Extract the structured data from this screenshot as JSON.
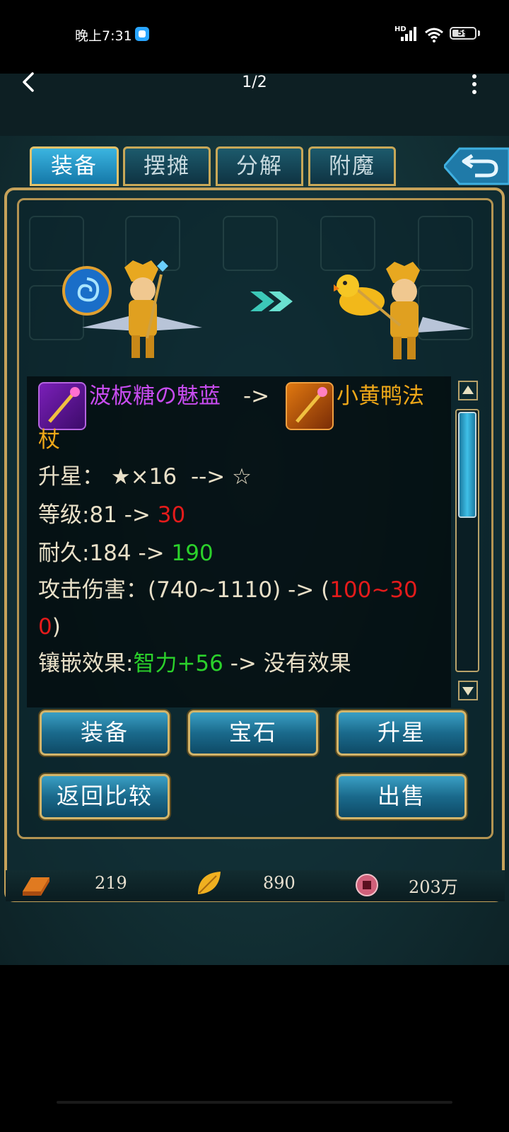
{
  "status_bar": {
    "time": "晚上7:31",
    "network": "HD",
    "battery": "59",
    "battery_level": 0.59
  },
  "viewer": {
    "page_indicator": "1/2"
  },
  "tabs": [
    {
      "label": "装备",
      "active": true
    },
    {
      "label": "摆摊",
      "active": false
    },
    {
      "label": "分解",
      "active": false
    },
    {
      "label": "附魔",
      "active": false
    }
  ],
  "compare": {
    "old_item_name": "波板糖の魅蓝",
    "arrow": "->",
    "new_item_name_part1": "小黄鸭法",
    "new_item_name_part2": "杖",
    "star_label": "升星：",
    "star_old": "★×16",
    "star_arrow": "-->",
    "star_new": "☆",
    "level_label": "等级:81 ->",
    "level_new": "30",
    "durability_label": "耐久:184 ->",
    "durability_new": "190",
    "attack_label": "攻击伤害：(740~1110) -> (",
    "attack_new_part1": "100~30",
    "attack_new_part2": "0",
    "attack_close": ")",
    "inlay_label": "镶嵌效果:",
    "inlay_old": "智力+56",
    "inlay_arrow": "->",
    "inlay_new": "没有效果"
  },
  "buttons": {
    "equip": "装备",
    "gem": "宝石",
    "upgrade_star": "升星",
    "back_compare": "返回比较",
    "sell": "出售"
  },
  "currency": {
    "gold": "219",
    "leaf": "890",
    "coin": "203万"
  }
}
